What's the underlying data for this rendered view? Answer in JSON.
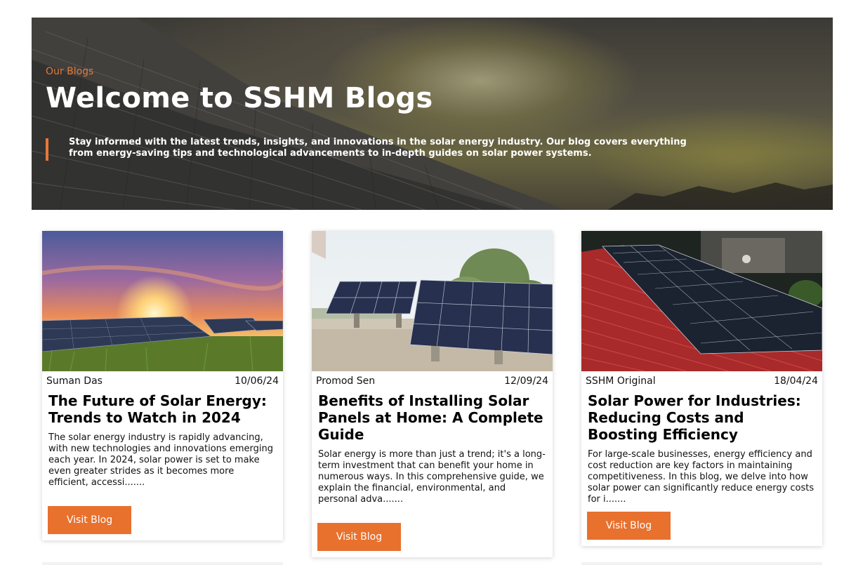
{
  "hero": {
    "eyebrow": "Our Blogs",
    "title": "Welcome to SSHM Blogs",
    "description": "Stay informed with the latest trends, insights, and innovations in the solar energy industry. Our blog covers everything from energy-saving tips and technological advancements to in-depth guides on solar power systems."
  },
  "colors": {
    "accent": "#e8712e",
    "hero_eyebrow": "#e8773a"
  },
  "posts": [
    {
      "author": "Suman Das",
      "date": "10/06/24",
      "title": "The Future of Solar Energy: Trends to Watch in 2024",
      "excerpt": "The solar energy industry is rapidly advancing, with new technologies and innovations emerging each year. In 2024, solar power is set to make even greater strides as it becomes more efficient, accessi.......",
      "button": "Visit Blog"
    },
    {
      "author": "Promod Sen",
      "date": "12/09/24",
      "title": "Benefits of Installing Solar Panels at Home: A Complete Guide",
      "excerpt": "Solar energy is more than just a trend; it's a long-term investment that can benefit your home in numerous ways. In this comprehensive guide, we explain the financial, environmental, and personal adva.......",
      "button": "Visit Blog"
    },
    {
      "author": "SSHM Original",
      "date": "18/04/24",
      "title": "Solar Power for Industries: Reducing Costs and Boosting Efficiency",
      "excerpt": "For large-scale businesses, energy efficiency and cost reduction are key factors in maintaining competitiveness. In this blog, we delve into how solar power can significantly reduce energy costs for i.......",
      "button": "Visit Blog"
    }
  ]
}
